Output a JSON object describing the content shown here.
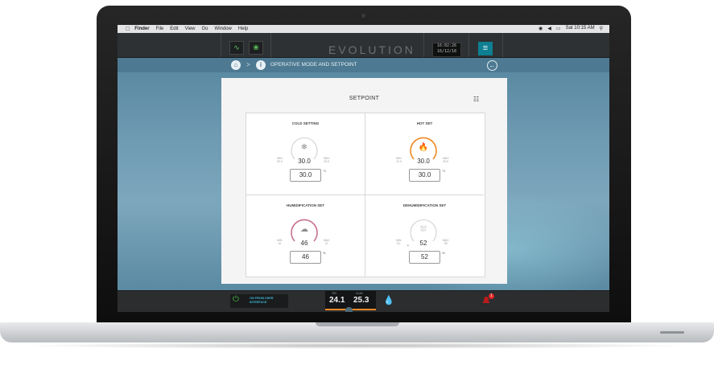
{
  "menubar": {
    "items": [
      "Finder",
      "File",
      "Edit",
      "View",
      "Go",
      "Window",
      "Help"
    ],
    "clock": "Sat 10:15 AM"
  },
  "topbar": {
    "logo": "EVOLUTION",
    "clock_time": "16:02:26",
    "clock_date": "16/12/18",
    "menu_icon": "hamburger-icon"
  },
  "breadcrumb": {
    "title": "OPERATIVE MODE AND SETPOINT",
    "separator": ">"
  },
  "panel": {
    "title": "SETPOINT",
    "cells": [
      {
        "title": "COLD SETTING",
        "icon": "snowflake-icon",
        "min_label": "MIN",
        "min": "00.0",
        "max_label": "MAX",
        "max": "30.0",
        "value": "30.0",
        "input": "30.0",
        "unit": "°C",
        "color": "#cfcfcf"
      },
      {
        "title": "HOT SET",
        "icon": "flame-icon",
        "min_label": "MIN",
        "min": "12.0",
        "max_label": "MAX",
        "max": "30.0",
        "value": "30.0",
        "input": "30.0",
        "unit": "°C",
        "color": "#f08a25"
      },
      {
        "title": "HUMIDIFICATION SET",
        "icon": "cloud-icon",
        "min_label": "MIN",
        "min": "10",
        "max_label": "MAX",
        "max": "47",
        "value": "46",
        "input": "46",
        "unit": "%",
        "color": "#c9718e"
      },
      {
        "title": "DEHUMIDIFICATION SET",
        "icon": "rain-icon",
        "min_label": "MIN",
        "min": "51",
        "max_label": "MAX",
        "max": "99",
        "value": "52",
        "input": "52",
        "unit": "%",
        "color": "#cfcfcf"
      }
    ]
  },
  "bottombar": {
    "on_text_line1": "ON FROM USER",
    "on_text_line2": "INTERFACE",
    "temp1_label": "TRI",
    "temp1": "24.1",
    "temp2_label": "CLIM",
    "temp2": "25.3",
    "accent": "#f08a25",
    "alarm_count": "1"
  }
}
